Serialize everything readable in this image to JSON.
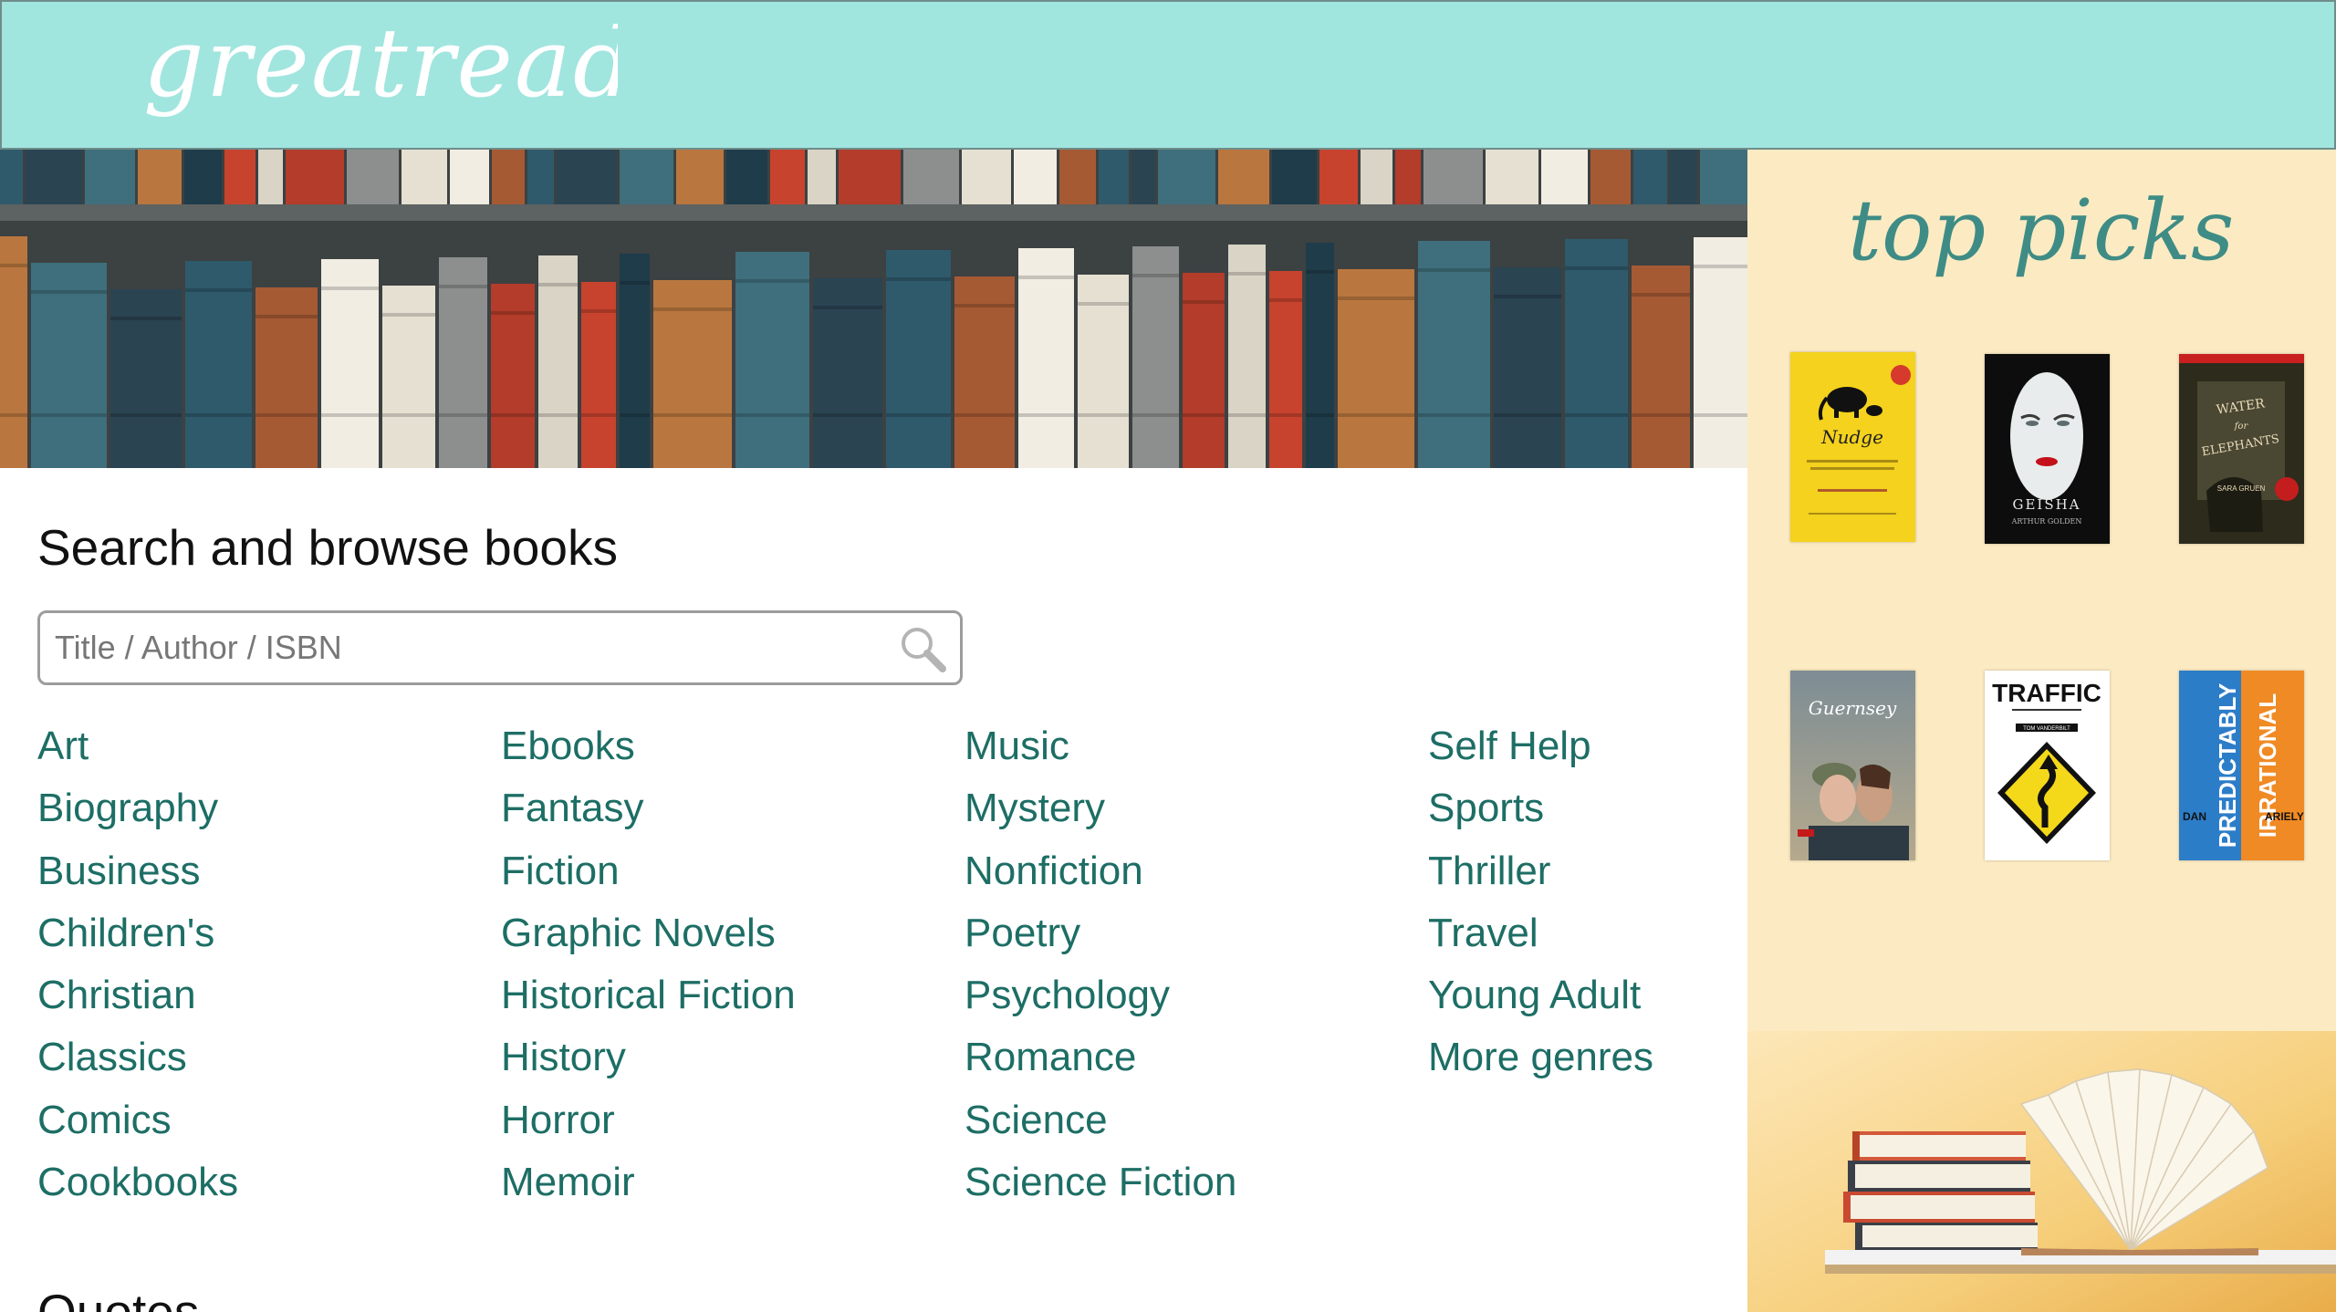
{
  "header": {
    "logo_text": "greatreads",
    "bg_color": "#a1e5df"
  },
  "main": {
    "section_title": "Search and browse books",
    "search": {
      "placeholder": "Title / Author / ISBN",
      "value": "",
      "icon": "search-icon"
    },
    "genre_columns": [
      [
        "Art",
        "Biography",
        "Business",
        "Children's",
        "Christian",
        "Classics",
        "Comics",
        "Cookbooks"
      ],
      [
        "Ebooks",
        "Fantasy",
        "Fiction",
        "Graphic Novels",
        "Historical Fiction",
        "History",
        "Horror",
        "Memoir"
      ],
      [
        "Music",
        "Mystery",
        "Nonfiction",
        "Poetry",
        "Psychology",
        "Romance",
        "Science",
        "Science Fiction"
      ],
      [
        "Self Help",
        "Sports",
        "Thriller",
        "Travel",
        "Young Adult",
        "More genres"
      ]
    ],
    "link_color": "#1d6e65",
    "next_heading_partial": "Quotes"
  },
  "sidebar": {
    "title": "top picks",
    "bg_color": "#fcebc2",
    "books": [
      {
        "title": "Nudge"
      },
      {
        "title": "Memoirs of a Geisha",
        "cover_text": "GEISHA",
        "author_text": "ARTHUR GOLDEN"
      },
      {
        "title": "Water for Elephants",
        "cover_text": "WATER for ELEPHANTS",
        "author_text": "SARA GRUEN"
      },
      {
        "title": "The Guernsey Literary and Potato Peel Pie Society",
        "cover_text": "Guernsey"
      },
      {
        "title": "Traffic",
        "cover_text": "TRAFFIC",
        "author_text": "TOM VANDERBILT"
      },
      {
        "title": "Predictably Irrational",
        "cover_text_1": "PREDICTABLY",
        "cover_text_2": "IRRATIONAL",
        "author_first": "DAN",
        "author_last": "ARIELY"
      }
    ]
  }
}
